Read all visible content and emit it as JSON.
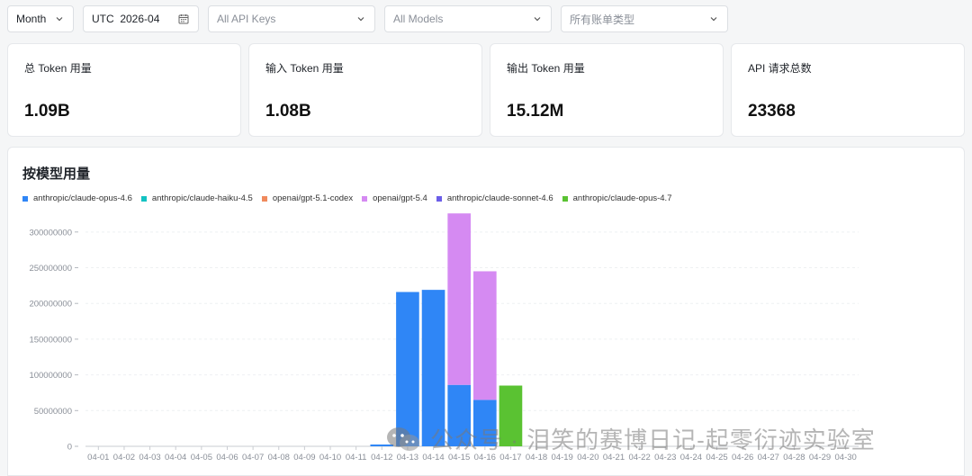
{
  "filters": {
    "period": "Month",
    "month_label": "UTC  2026-04",
    "api_keys": "All API Keys",
    "models": "All Models",
    "bill_type": "所有账单类型"
  },
  "stats": [
    {
      "label": "总 Token 用量",
      "value": "1.09B"
    },
    {
      "label": "输入 Token 用量",
      "value": "1.08B"
    },
    {
      "label": "输出 Token 用量",
      "value": "15.12M"
    },
    {
      "label": "API 请求总数",
      "value": "23368"
    }
  ],
  "panel_title": "按模型用量",
  "watermark": "公众号 · 泪笑的赛博日记-起零衍迹实验室",
  "chart_data": {
    "type": "bar",
    "stacked": true,
    "title": "",
    "xlabel": "",
    "ylabel": "",
    "ylim": [
      0,
      330000000
    ],
    "yticks": [
      0,
      50000000,
      100000000,
      150000000,
      200000000,
      250000000,
      300000000
    ],
    "ytick_labels": [
      "0",
      "50000000",
      "100000000",
      "150000000",
      "200000000",
      "250000000",
      "300000000"
    ],
    "grid": true,
    "legend_position": "top-left",
    "categories": [
      "04-01",
      "04-02",
      "04-03",
      "04-04",
      "04-05",
      "04-06",
      "04-07",
      "04-08",
      "04-09",
      "04-10",
      "04-11",
      "04-12",
      "04-13",
      "04-14",
      "04-15",
      "04-16",
      "04-17",
      "04-18",
      "04-19",
      "04-20",
      "04-21",
      "04-22",
      "04-23",
      "04-24",
      "04-25",
      "04-26",
      "04-27",
      "04-28",
      "04-29",
      "04-30"
    ],
    "x_tick_labels": [
      "04-01",
      "04-02",
      "04-03",
      "04-04",
      "04-05",
      "04-06",
      "04-07",
      "04-08",
      "04-09",
      "04-10",
      "04-11",
      "04-12",
      "04-13",
      "04-14",
      "04-15",
      "04-16",
      "04-17",
      "04-18",
      "04-19",
      "04-20",
      "04-21",
      "04-22",
      "04-23",
      "04-24",
      "04-25",
      "04-26",
      "04-27",
      "04-28",
      "04-29",
      "04-30"
    ],
    "series": [
      {
        "name": "anthropic/claude-opus-4.6",
        "color": "#2f86f6",
        "values": [
          0,
          0,
          0,
          0,
          0,
          0,
          0,
          0,
          0,
          0,
          0,
          2500000,
          216000000,
          219000000,
          86000000,
          65000000,
          0,
          0,
          0,
          0,
          0,
          0,
          0,
          0,
          0,
          0,
          0,
          0,
          0,
          0
        ]
      },
      {
        "name": "anthropic/claude-haiku-4.5",
        "color": "#13c2c2",
        "values": [
          0,
          0,
          0,
          0,
          0,
          0,
          0,
          0,
          0,
          0,
          0,
          0,
          0,
          0,
          0,
          0,
          0,
          0,
          0,
          0,
          0,
          0,
          0,
          0,
          0,
          0,
          0,
          0,
          0,
          0
        ]
      },
      {
        "name": "openai/gpt-5.1-codex",
        "color": "#f08a5d",
        "values": [
          0,
          0,
          0,
          0,
          0,
          0,
          0,
          0,
          0,
          0,
          0,
          0,
          0,
          0,
          0,
          0,
          0,
          0,
          0,
          0,
          0,
          0,
          0,
          0,
          0,
          0,
          0,
          0,
          0,
          0
        ]
      },
      {
        "name": "openai/gpt-5.4",
        "color": "#d58af2",
        "values": [
          0,
          0,
          0,
          0,
          0,
          0,
          0,
          0,
          0,
          0,
          0,
          0,
          0,
          0,
          240000000,
          180000000,
          0,
          0,
          0,
          0,
          0,
          0,
          0,
          0,
          0,
          0,
          0,
          0,
          0,
          0
        ]
      },
      {
        "name": "anthropic/claude-sonnet-4.6",
        "color": "#6b5ee8",
        "values": [
          0,
          0,
          0,
          0,
          0,
          0,
          0,
          0,
          0,
          0,
          0,
          0,
          0,
          0,
          0,
          0,
          0,
          0,
          0,
          0,
          0,
          0,
          0,
          0,
          0,
          0,
          0,
          0,
          0,
          0
        ]
      },
      {
        "name": "anthropic/claude-opus-4.7",
        "color": "#5ac232",
        "values": [
          0,
          0,
          0,
          0,
          0,
          0,
          0,
          0,
          0,
          0,
          0,
          0,
          0,
          0,
          0,
          0,
          85000000,
          0,
          0,
          0,
          0,
          0,
          0,
          0,
          0,
          0,
          0,
          0,
          0,
          0
        ]
      }
    ]
  }
}
